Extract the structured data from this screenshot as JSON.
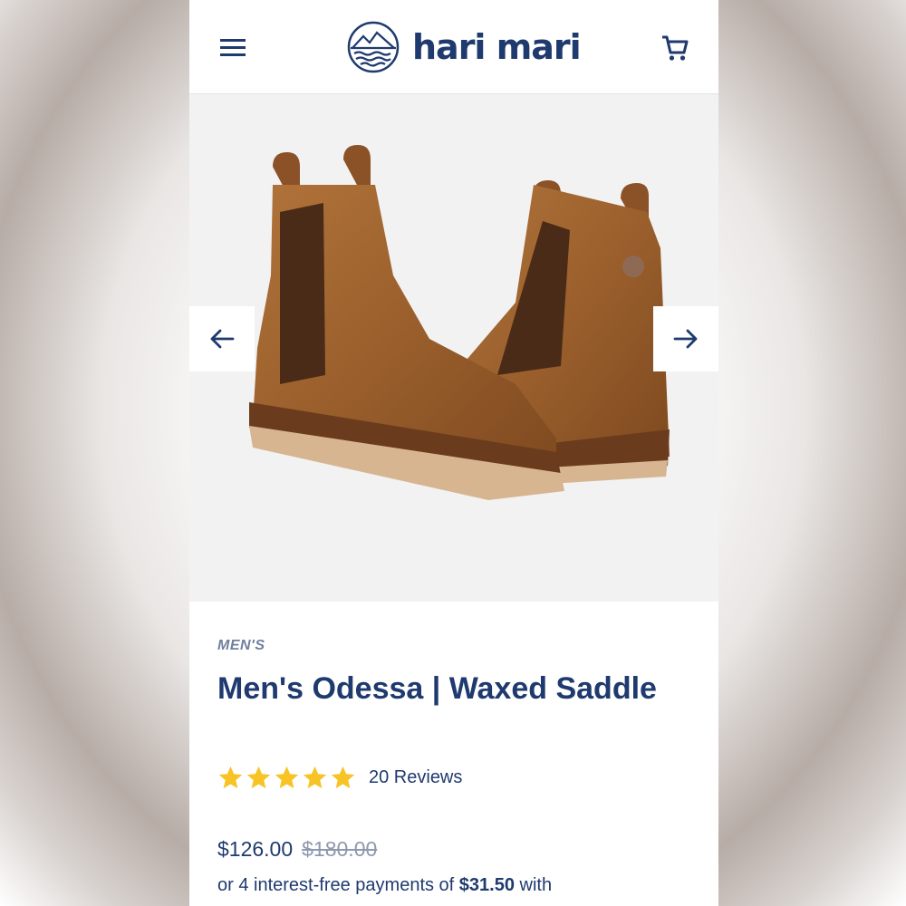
{
  "header": {
    "brand": "hari mari",
    "menu_icon": "hamburger-menu-icon",
    "cart_icon": "shopping-cart-icon",
    "logo_icon": "mountain-waves-logo"
  },
  "gallery": {
    "prev_icon": "arrow-left-icon",
    "next_icon": "arrow-right-icon"
  },
  "product": {
    "category": "MEN'S",
    "title": "Men's Odessa | Waxed Saddle",
    "rating": 5,
    "reviews_label": "20 Reviews",
    "price": "$126.00",
    "compare_price": "$180.00",
    "installments_prefix": "or 4 interest-free payments of",
    "installments_amount": "$31.50",
    "installments_suffix": "with"
  },
  "colors": {
    "brand_navy": "#1f3a6e",
    "star_yellow": "#f7c325",
    "gallery_bg": "#f2f2f2"
  }
}
